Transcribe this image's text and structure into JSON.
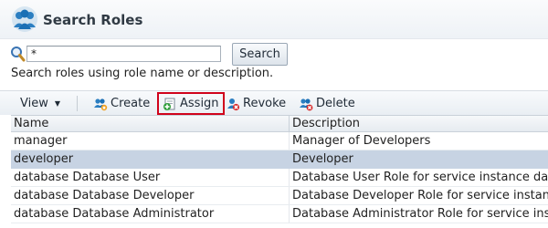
{
  "header": {
    "title": "Search Roles",
    "icon": "users-group-icon"
  },
  "search": {
    "value": "*",
    "placeholder": "",
    "button_label": "Search",
    "hint": "Search roles using role name or description."
  },
  "toolbar": {
    "view_label": "View",
    "create_label": "Create",
    "assign_label": "Assign",
    "revoke_label": "Revoke",
    "delete_label": "Delete",
    "highlight_color": "#d0021b"
  },
  "table": {
    "columns": [
      "Name",
      "Description"
    ],
    "rows": [
      {
        "name": "manager",
        "description": "Manager of Developers",
        "selected": false
      },
      {
        "name": "developer",
        "description": "Developer",
        "selected": true
      },
      {
        "name": "database Database User",
        "description": "Database User Role for service instance database",
        "selected": false
      },
      {
        "name": "database Database Developer",
        "description": "Database Developer Role for service instance database",
        "selected": false
      },
      {
        "name": "database Database Administrator",
        "description": "Database Administrator Role for service instance database",
        "selected": false
      }
    ]
  },
  "colors": {
    "selected_row": "#c7d3e3",
    "accent": "#1a6fb5"
  }
}
